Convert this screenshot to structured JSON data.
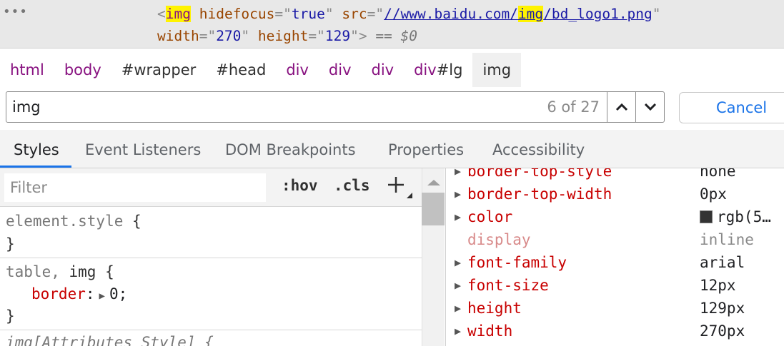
{
  "dom_snippet": {
    "ellipsis": "•••",
    "line1": {
      "open": "<",
      "tag": "img",
      "attr1_name": "hidefocus",
      "attr1_eq": "=\"",
      "attr1_val": "true",
      "attr1_close": "\"",
      "attr2_name": "src",
      "attr2_eq": "=\"",
      "attr2_val_pre": "//www.baidu.com/",
      "attr2_val_hl": "img",
      "attr2_val_post": "/bd_logo1.png",
      "attr2_close": "\""
    },
    "line2": {
      "attr3_name": "width",
      "attr3_eq": "=\"",
      "attr3_val": "270",
      "attr3_close": "\"",
      "attr4_name": "height",
      "attr4_eq": "=\"",
      "attr4_val": "129",
      "attr4_close": "\">",
      "equals": " == ",
      "ref": "$0"
    }
  },
  "breadcrumb": [
    {
      "label": "html",
      "style": "purple"
    },
    {
      "label": "body",
      "style": "purple"
    },
    {
      "label": "#wrapper",
      "style": "dark"
    },
    {
      "label": "#head",
      "style": "dark"
    },
    {
      "label": "div",
      "style": "purple"
    },
    {
      "label": "div",
      "style": "purple"
    },
    {
      "label": "div",
      "style": "purple"
    },
    {
      "label": "div",
      "suffix": "#lg",
      "style": "purple"
    },
    {
      "label": "img",
      "style": "active"
    }
  ],
  "search": {
    "value": "img",
    "count": "6 of 27",
    "cancel_label": "Cancel"
  },
  "tabs": [
    {
      "label": "Styles",
      "active": true
    },
    {
      "label": "Event Listeners",
      "active": false
    },
    {
      "label": "DOM Breakpoints",
      "active": false
    },
    {
      "label": "Properties",
      "active": false
    },
    {
      "label": "Accessibility",
      "active": false
    }
  ],
  "styles": {
    "filter_placeholder": "Filter",
    "hov_label": ":hov",
    "cls_label": ".cls",
    "rules": {
      "element_selector": "element.style",
      "open_brace": " {",
      "close_brace": "}",
      "table_selector_1": "table, ",
      "table_selector_2": "img",
      "table_prop": "border",
      "table_colon": ":",
      "table_val": "0",
      "table_semicolon": ";",
      "attrs_selector": "img[Attributes Style] {"
    }
  },
  "computed": [
    {
      "prop": "border-top-style",
      "value": "none",
      "expandable": true
    },
    {
      "prop": "border-top-width",
      "value": "0px",
      "expandable": true
    },
    {
      "prop": "color",
      "value": "rgb(5…",
      "expandable": true,
      "swatch": "#333333"
    },
    {
      "prop": "display",
      "value": "inline",
      "expandable": false,
      "inherited": true
    },
    {
      "prop": "font-family",
      "value": "arial",
      "expandable": true
    },
    {
      "prop": "font-size",
      "value": "12px",
      "expandable": true
    },
    {
      "prop": "height",
      "value": "129px",
      "expandable": true
    },
    {
      "prop": "width",
      "value": "270px",
      "expandable": true
    }
  ],
  "colors": {
    "tag": "#881280",
    "property": "#c80000",
    "accent": "#1a73e8",
    "highlight": "#fff300"
  }
}
